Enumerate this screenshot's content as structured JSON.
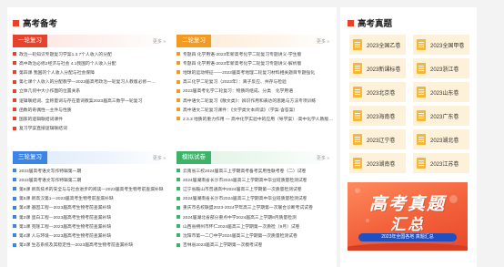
{
  "left_section": {
    "title": "高考备考"
  },
  "right_section": {
    "title": "高考真题"
  },
  "cards": {
    "first": {
      "tag": "一轮复习",
      "more": "更多 »",
      "items": [
        "政治一轮知识专题复习学案1.3.7个人收入的分配",
        "高中政治必修2经济与社会 4.1我国的个人收入分配",
        "第四课 我国的个人收入分配与社会保障",
        "第七课个人收入的分配教学—2023届高考政治一轮复习人教版必修一…",
        "立体几何中大小作面的位置关系",
        "逻辑联结词、全称量词与存在量词教案2023届高三数学一轮复习",
        "函数的奇偶性—主件与性质",
        "国家的逻辑联结词课件",
        "复习学案直接逻辑联结词"
      ]
    },
    "second": {
      "tag": "二轮复习",
      "more": "更多 »",
      "items": [
        "专题四 化学用语-2023年新高考化学二轮复习专题讲义-学生版",
        "专题四 化学用语-2023年新高考化学二轮复习专题讲义-解析版",
        "地球的运动特征——2023届高考地理二轮复习材料相关题目专题强化",
        "高三化学二轮复习（2023年）：离子反应、共存与检验",
        "2023届高考化学二轮复习：物质的组成、分类　化学用语",
        "高中语文二轮复习《散文类》：辨识作用和表达的思路与方法专项训练",
        "高中语文二轮复习课件：《文学类文本阅读》（学案-含答案）",
        "2.3.3 地质的重力作用  — 高中化学实验中的应用（导学案）-高中化学人教版（2…",
        ""
      ]
    },
    "third": {
      "tag": "三轮复习",
      "more": "更多 »",
      "items": [
        "2023届高考语文写作特辑第一期",
        "2023届高考语文写作特辑第二期",
        "第6课 新高技术的安全与与社会进步的阅读—2023届高考生物考前查漏补缺",
        "第5课 新高汉第1—2023届高考生物考前查漏补缺",
        "第4课 基因工程—2023届高考生物考前查漏补缺",
        "第2课 蛋白工程—2023届高考生物考前查漏补缺",
        "第1课 克隆工程—2023届高考生物考前查漏补缺",
        "第4课 人与环境—2023届高考生物考前查漏补缺",
        "第3课 生态系统及其稳定性—2023届高考生物考前查漏补缺"
      ]
    },
    "fourth": {
      "tag": "模拟试卷",
      "more": "更多 »",
      "items": [
        "云南省三校2024届高三上学期高考备考实用性联考卷（二）试卷",
        "2024届湖南省长沙市2024届高三上学期高中毕业班质量检测试卷",
        "辽宁省鞍山市普通高中2024届高三上学期第一次质量检测试卷",
        "2024届湖南省长沙市2024届高三上学期高中毕业班质量检测试卷",
        "重庆市名校联盟2023-2024学年高三上学期第一次联合诊断考试试卷",
        "2024届湖北省部分重点中学2024届高三上学期8月质量检测",
        "山西省朔州市怀仁2024届高三上学期第一次质检（9月）试卷",
        "沈阳市第一二〇中学2024届高三上学期第一次质量检测试卷",
        "吉林省2023届高三上学期第一次模考试卷"
      ]
    }
  },
  "exams": [
    "2023全国乙卷",
    "2023全国甲卷",
    "2023新课标卷",
    "2023浙江卷",
    "2023北京卷",
    "2023山东卷",
    "2023海南卷",
    "2023广东卷",
    "2023辽宁卷",
    "2023湖北卷",
    "2023湖南卷",
    "2023江苏卷"
  ],
  "banner": {
    "line1": "高考真题",
    "line2": "汇总",
    "pill": "2023年全国各地  真题汇总"
  },
  "colors": {
    "red": "#e6432c",
    "orange": "#f39a23",
    "blue": "#3c84e6",
    "green": "#3bb46a",
    "banner": "#f2603a"
  }
}
